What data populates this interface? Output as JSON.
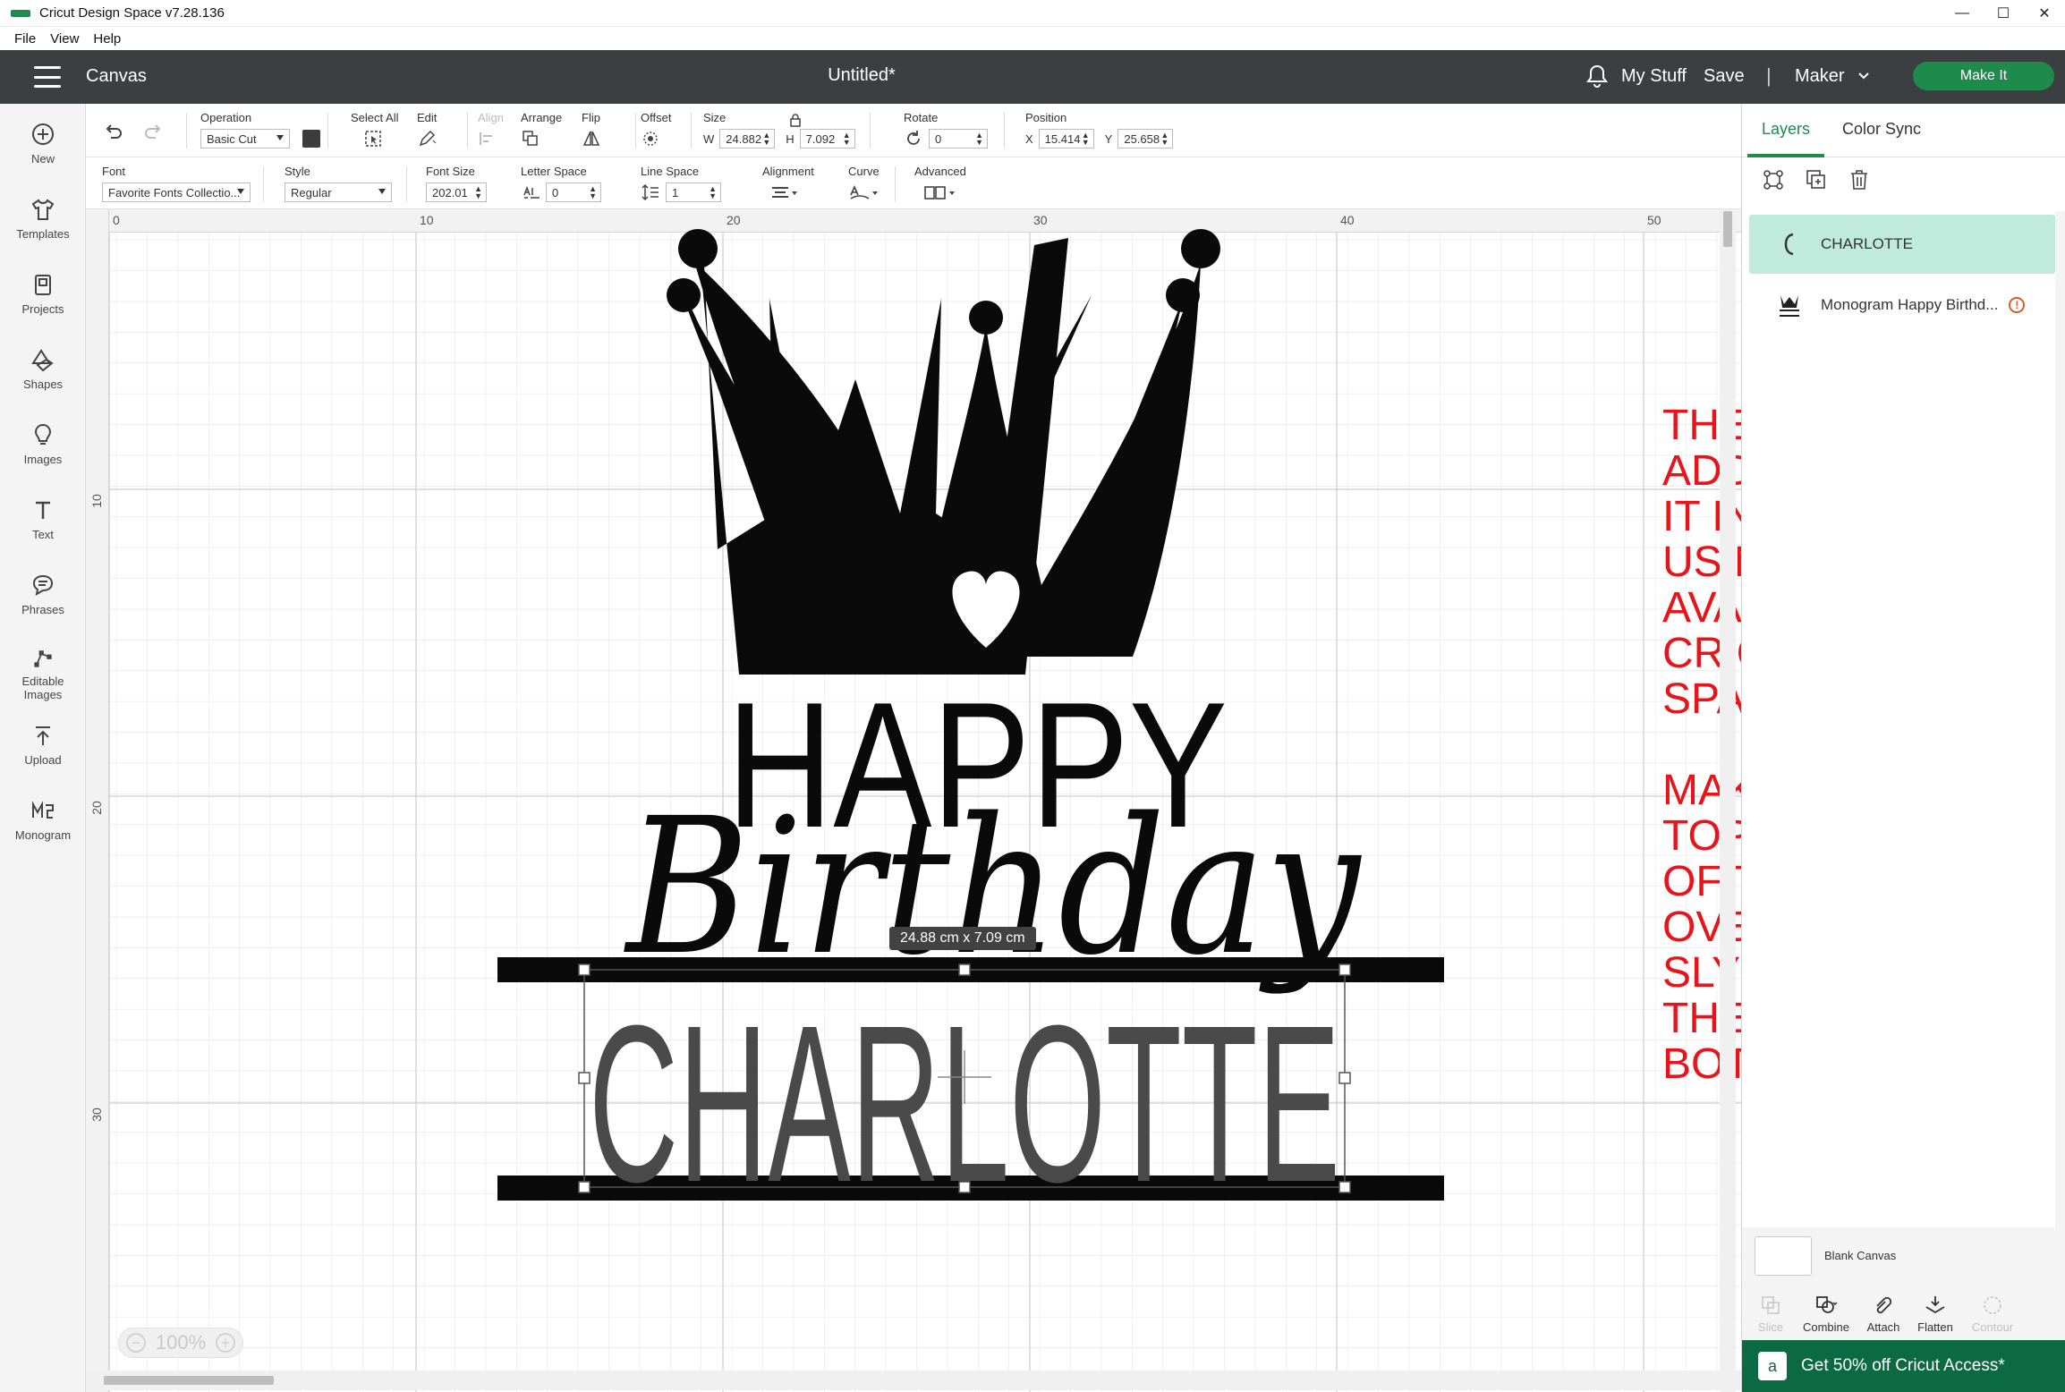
{
  "window": {
    "title": "Cricut Design Space  v7.28.136",
    "controls": [
      "—",
      "☐",
      "✕"
    ]
  },
  "menu": [
    "File",
    "View",
    "Help"
  ],
  "header": {
    "section": "Canvas",
    "document_title": "Untitled*",
    "my_stuff": "My Stuff",
    "save": "Save",
    "separator": "|",
    "machine": "Maker",
    "make_it": "Make It"
  },
  "left_nav": [
    {
      "label": "New",
      "icon": "plus-circle-icon"
    },
    {
      "label": "Templates",
      "icon": "tshirt-icon"
    },
    {
      "label": "Projects",
      "icon": "projects-icon"
    },
    {
      "label": "Shapes",
      "icon": "shapes-icon"
    },
    {
      "label": "Images",
      "icon": "lightbulb-icon"
    },
    {
      "label": "Text",
      "icon": "text-icon"
    },
    {
      "label": "Phrases",
      "icon": "speech-bubble-icon"
    },
    {
      "label": "Editable Images",
      "icon": "editable-images-icon"
    },
    {
      "label": "Upload",
      "icon": "upload-icon"
    },
    {
      "label": "Monogram",
      "icon": "monogram-icon"
    }
  ],
  "edit_bar": {
    "operation_label": "Operation",
    "operation_value": "Basic Cut",
    "operation_color": "#3c3c3c",
    "select_all": "Select All",
    "edit": "Edit",
    "align": "Align",
    "arrange": "Arrange",
    "flip": "Flip",
    "offset": "Offset",
    "size_label": "Size",
    "size_w_label": "W",
    "size_w": "24.882",
    "size_h_label": "H",
    "size_h": "7.092",
    "rotate_label": "Rotate",
    "rotate": "0",
    "position_label": "Position",
    "pos_x_label": "X",
    "pos_x": "15.414",
    "pos_y_label": "Y",
    "pos_y": "25.658"
  },
  "text_bar": {
    "font_label": "Font",
    "font_value": "Favorite Fonts Collectio...",
    "style_label": "Style",
    "style_value": "Regular",
    "font_size_label": "Font Size",
    "font_size": "202.01",
    "letter_space_label": "Letter Space",
    "letter_space": "0",
    "line_space_label": "Line Space",
    "line_space": "1",
    "alignment_label": "Alignment",
    "curve_label": "Curve",
    "advanced_label": "Advanced"
  },
  "canvas": {
    "ruler_top": [
      "0",
      "10",
      "20",
      "30",
      "40",
      "50"
    ],
    "ruler_left": [
      "10",
      "20",
      "30"
    ],
    "zoom": "100%",
    "dimension_tag": "24.88  cm x 7.09  cm",
    "design_words": {
      "happy": "HAPPY",
      "birthday": "Birthday",
      "name": "CHARLOTTE"
    },
    "annotation": [
      "THE NAME IS",
      "ADDED BY TYPING",
      "IT IN THE AREA",
      "USING THE FONTS",
      "AVAILABLE FROM",
      "CRICUT DESIGN",
      "SPACE.",
      "",
      "MAKE SURE THE",
      "TOP AND BOTTOM",
      "OF THE LETTERS",
      "OVERLAP",
      "SLYGHTLY OVER",
      "THE TOP AND",
      "BOTTOM LINES."
    ],
    "annotation_color": "#e8141a"
  },
  "right_panel": {
    "tabs": [
      "Layers",
      "Color Sync"
    ],
    "layers": [
      {
        "name": "CHARLOTTE",
        "selected": true
      },
      {
        "name": "Monogram Happy Birthd...",
        "selected": false,
        "warning": "!"
      }
    ],
    "blank_canvas": "Blank Canvas",
    "bottom_tools": [
      {
        "label": "Slice",
        "enabled": false
      },
      {
        "label": "Combine",
        "enabled": true
      },
      {
        "label": "Attach",
        "enabled": true
      },
      {
        "label": "Flatten",
        "enabled": true
      },
      {
        "label": "Contour",
        "enabled": false
      }
    ],
    "promo": "Get 50% off Cricut Access*"
  },
  "colors": {
    "header_bg": "#3b3f42",
    "brand_green": "#1e8a4c",
    "selected_layer": "#bfeadc",
    "promo_bg": "#0b6a41"
  }
}
